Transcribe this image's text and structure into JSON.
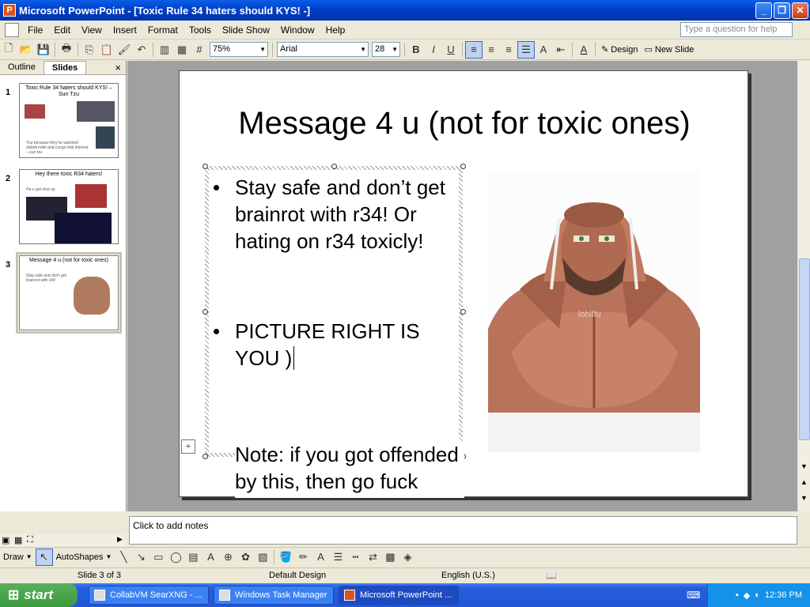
{
  "window": {
    "title": "Microsoft PowerPoint - [Toxic Rule 34 haters should KYS! -]"
  },
  "menu": [
    "File",
    "Edit",
    "View",
    "Insert",
    "Format",
    "Tools",
    "Slide Show",
    "Window",
    "Help"
  ],
  "help_box": {
    "placeholder": "Type a question for help"
  },
  "toolbar": {
    "zoom": "75%",
    "font": "Arial",
    "size": "28",
    "design_label": "Design",
    "new_slide_label": "New Slide"
  },
  "left_pane": {
    "tabs": [
      "Outline",
      "Slides"
    ],
    "close": "×"
  },
  "thumbs": [
    {
      "num": "1",
      "title": "Toxic Rule 34 haters should KYS! – Sun Tzu",
      "text": "You because they've watched skibidi toilet and congo bnb internet – sun tzu"
    },
    {
      "num": "2",
      "title": "Hey there toxic R34 haters!",
      "text": "Ha u got shut up"
    },
    {
      "num": "3",
      "title": "Message 4 u (not for toxic ones)",
      "text": "Stay safe and don't get brainrot with r34!"
    }
  ],
  "slide": {
    "title": "Message 4 u (not for toxic ones)",
    "bullets": [
      "Stay safe and don’t get brainrot with r34! Or hating on r34 toxicly!",
      "PICTURE RIGHT IS YOU )",
      "Note: if you got offended by this, then go fuck yourself."
    ],
    "bullet_char": "•",
    "watermark": "lohilfu"
  },
  "notes": {
    "placeholder": "Click to add notes"
  },
  "draw": {
    "draw_label": "Draw",
    "autoshapes_label": "AutoShapes"
  },
  "status": {
    "slide": "Slide 3 of 3",
    "design": "Default Design",
    "language": "English (U.S.)"
  },
  "taskbar": {
    "start": "start",
    "tasks": [
      "CollabVM SearXNG - ...",
      "Windows Task Manager",
      "Microsoft PowerPoint ..."
    ],
    "clock": "12:36 PM"
  }
}
